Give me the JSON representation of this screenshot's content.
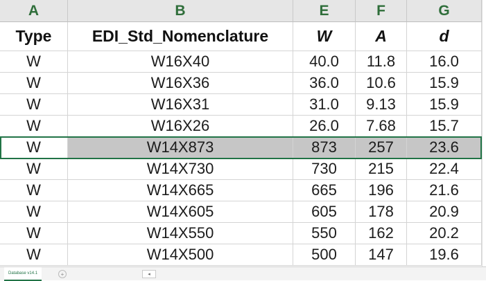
{
  "column_letters": [
    "A",
    "B",
    "E",
    "F",
    "G"
  ],
  "headers": [
    "Type",
    "EDI_Std_Nomenclature",
    "W",
    "A",
    "d"
  ],
  "rows": [
    [
      "W",
      "W16X40",
      "40.0",
      "11.8",
      "16.0"
    ],
    [
      "W",
      "W16X36",
      "36.0",
      "10.6",
      "15.9"
    ],
    [
      "W",
      "W16X31",
      "31.0",
      "9.13",
      "15.9"
    ],
    [
      "W",
      "W16X26",
      "26.0",
      "7.68",
      "15.7"
    ],
    [
      "W",
      "W14X873",
      "873",
      "257",
      "23.6"
    ],
    [
      "W",
      "W14X730",
      "730",
      "215",
      "22.4"
    ],
    [
      "W",
      "W14X665",
      "665",
      "196",
      "21.6"
    ],
    [
      "W",
      "W14X605",
      "605",
      "178",
      "20.9"
    ],
    [
      "W",
      "W14X550",
      "550",
      "162",
      "20.2"
    ],
    [
      "W",
      "W14X500",
      "500",
      "147",
      "19.6"
    ]
  ],
  "selected_row_index": 4,
  "sheet_tab": "Database v14.1",
  "tab_add_symbol": "+",
  "scroll_arrow": "◂",
  "colors": {
    "accent": "#217346",
    "highlight": "#c6c6c6",
    "column_header_bg": "#e6e6e6"
  }
}
